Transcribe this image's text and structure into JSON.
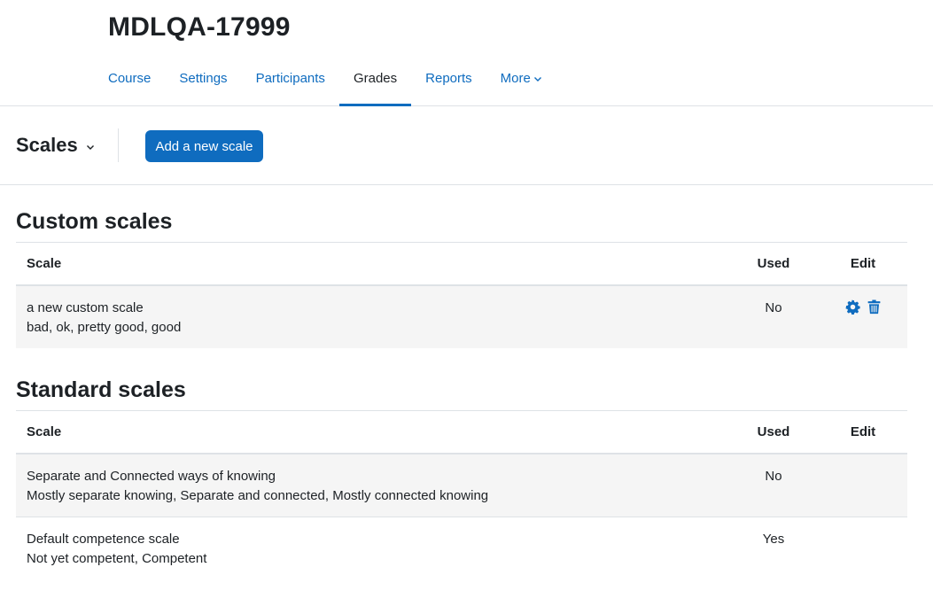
{
  "course": {
    "title": "MDLQA-17999"
  },
  "nav": {
    "tabs": [
      {
        "label": "Course"
      },
      {
        "label": "Settings"
      },
      {
        "label": "Participants"
      },
      {
        "label": "Grades",
        "active": true
      },
      {
        "label": "Reports"
      },
      {
        "label": "More"
      }
    ]
  },
  "toolbar": {
    "selector_label": "Scales",
    "add_button_label": "Add a new scale"
  },
  "custom_scales": {
    "heading": "Custom scales",
    "columns": {
      "scale": "Scale",
      "used": "Used",
      "edit": "Edit"
    },
    "rows": [
      {
        "name": "a new custom scale",
        "items": "bad, ok, pretty good, good",
        "used": "No",
        "actions": [
          "gear-icon",
          "trash-icon"
        ]
      }
    ]
  },
  "standard_scales": {
    "heading": "Standard scales",
    "columns": {
      "scale": "Scale",
      "used": "Used",
      "edit": "Edit"
    },
    "rows": [
      {
        "name": "Separate and Connected ways of knowing",
        "items": "Mostly separate knowing, Separate and connected, Mostly connected knowing",
        "used": "No"
      },
      {
        "name": "Default competence scale",
        "items": "Not yet competent, Competent",
        "used": "Yes"
      }
    ]
  },
  "colors": {
    "accent": "#0f6cbf",
    "text": "#1d2125",
    "stripe": "#f5f5f5",
    "border": "#dee2e6"
  }
}
